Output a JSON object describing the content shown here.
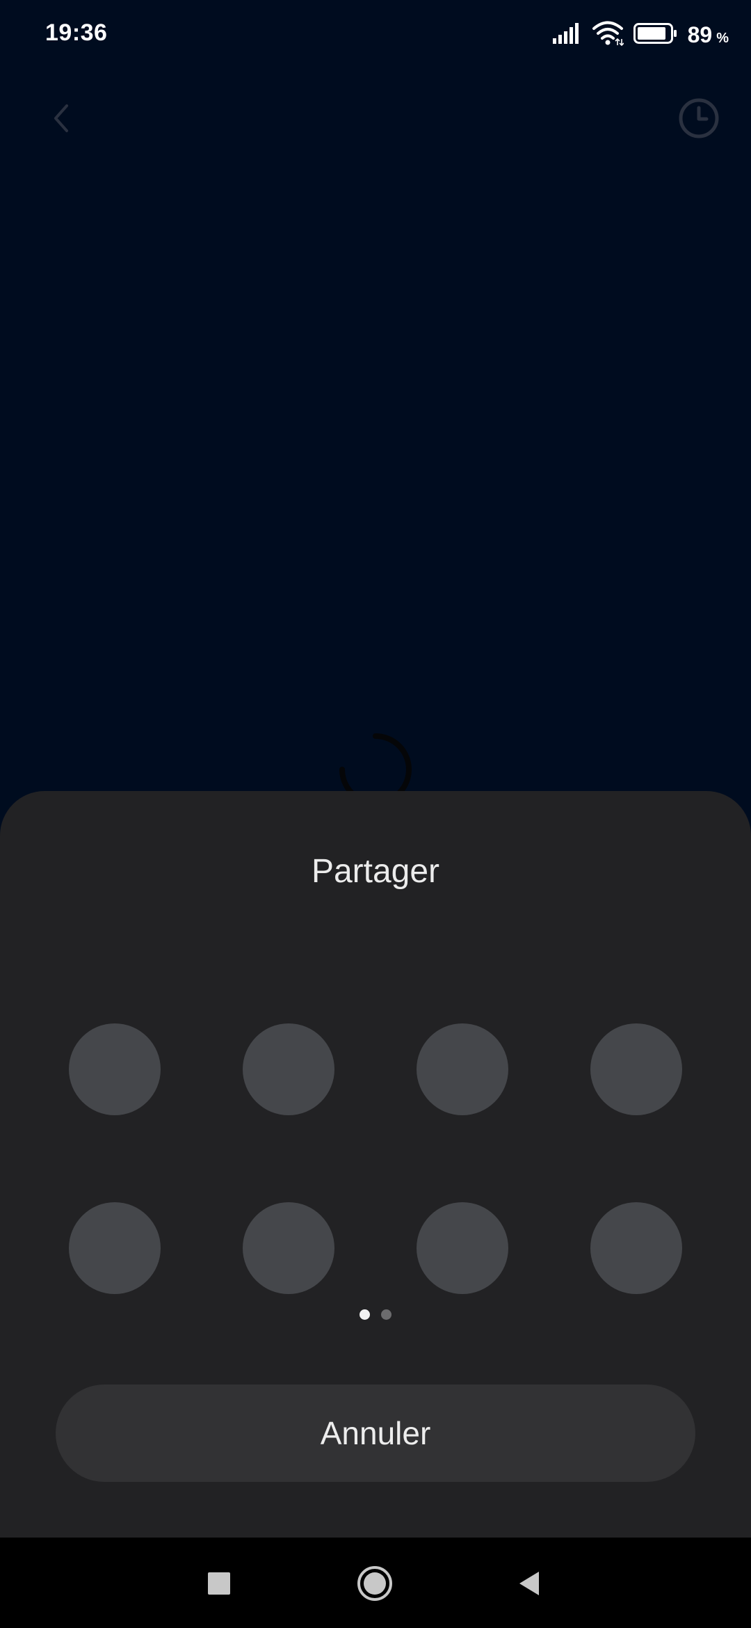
{
  "status_bar": {
    "time": "19:36",
    "battery_percent": "89",
    "battery_unit": "%",
    "battery_level": 0.89,
    "icons": [
      "signal-icon",
      "wifi-icon",
      "battery-icon"
    ]
  },
  "header": {
    "back_icon": "chevron-left-icon",
    "history_icon": "clock-icon"
  },
  "loading": {
    "icon": "loading-spinner-icon"
  },
  "share_sheet": {
    "title": "Partager",
    "app_slots_count": 8,
    "page_count": 2,
    "current_page": 1,
    "cancel_label": "Annuler"
  },
  "nav_bar": {
    "icons": [
      "recents-icon",
      "home-icon",
      "back-icon"
    ]
  },
  "colors": {
    "background": "#000c1f",
    "sheet": "#222224",
    "placeholder": "#45474b",
    "button": "#323234"
  }
}
